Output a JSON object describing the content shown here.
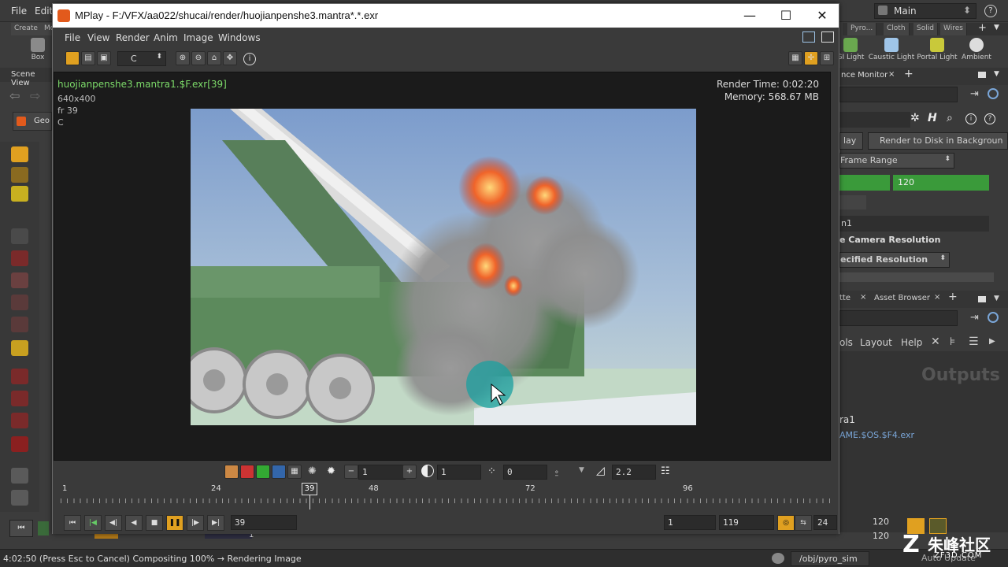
{
  "houdini": {
    "menu": [
      "File",
      "Edit"
    ],
    "desktop": "Main",
    "shelf_tabs_left": [
      "Create",
      "Mo"
    ],
    "shelf_tabs_right": [
      "Pyro...",
      "Cloth",
      "Solid",
      "Wires"
    ],
    "shelf_left_icon": "Box",
    "shelf_right_icons": [
      "GI Light",
      "Caustic Light",
      "Portal Light",
      "Ambient"
    ],
    "scene_view_label": "Scene View",
    "geo_tab": "Geo",
    "right_panel": {
      "perf_tab": "nce Monitor",
      "render_btn_left": "lay",
      "render_btn_right": "Render to Disk in Backgroun",
      "frame_range_menu": "Frame Range",
      "frame_end": "120",
      "camera_field": "n1",
      "camera_resolution": "e Camera Resolution",
      "specified_resolution": "ecified Resolution",
      "palette_tab": "tte",
      "asset_browser_tab": "Asset Browser",
      "menu_tools": "ols",
      "menu_layout": "Layout",
      "menu_help": "Help",
      "outputs_heading": "Outputs",
      "node_label": "ra1",
      "output_path": "AME.$OS.$F4.exr",
      "frame_a": "120",
      "frame_b": "120"
    },
    "network_path": "/obj/pyro_sim",
    "auto_update": "Auto Update",
    "status": "4:02:50 (Press Esc to Cancel) Compositing 100% → Rendering Image",
    "left_frame_marker": "1"
  },
  "mplay": {
    "title": "MPlay - F:/VFX/aa022/shucai/render/huojianpenshe3.mantra*.*.exr",
    "menu": [
      "File",
      "View",
      "Render",
      "Anim",
      "Image",
      "Windows"
    ],
    "channel": "C",
    "overlay": {
      "filename": "huojianpenshe3.mantra1.$F.exr[39]",
      "resolution": "640x400",
      "frame": "fr 39",
      "plane": "C",
      "render_time": "Render Time: 0:02:20",
      "memory": "Memory:    568.67 MB"
    },
    "display": {
      "brightness_value": "1",
      "gamma_value": "1",
      "offset_value": "0",
      "lut_gamma": "2.2"
    },
    "timeline_ticks": [
      "1",
      "24",
      "48",
      "72",
      "96"
    ],
    "current_frame_marker": "39",
    "current_frame": "39",
    "range_start": "1",
    "range_end": "119",
    "fps": "24"
  },
  "watermark": {
    "logo_cn": "朱峰社区",
    "logo_en": "ZF3D.COM"
  },
  "colors": {
    "accent_orange": "#e0a020",
    "houdini_orange": "#e25a1c",
    "green_field": "#3a9a3a",
    "filename_green": "#7ddc6a"
  }
}
